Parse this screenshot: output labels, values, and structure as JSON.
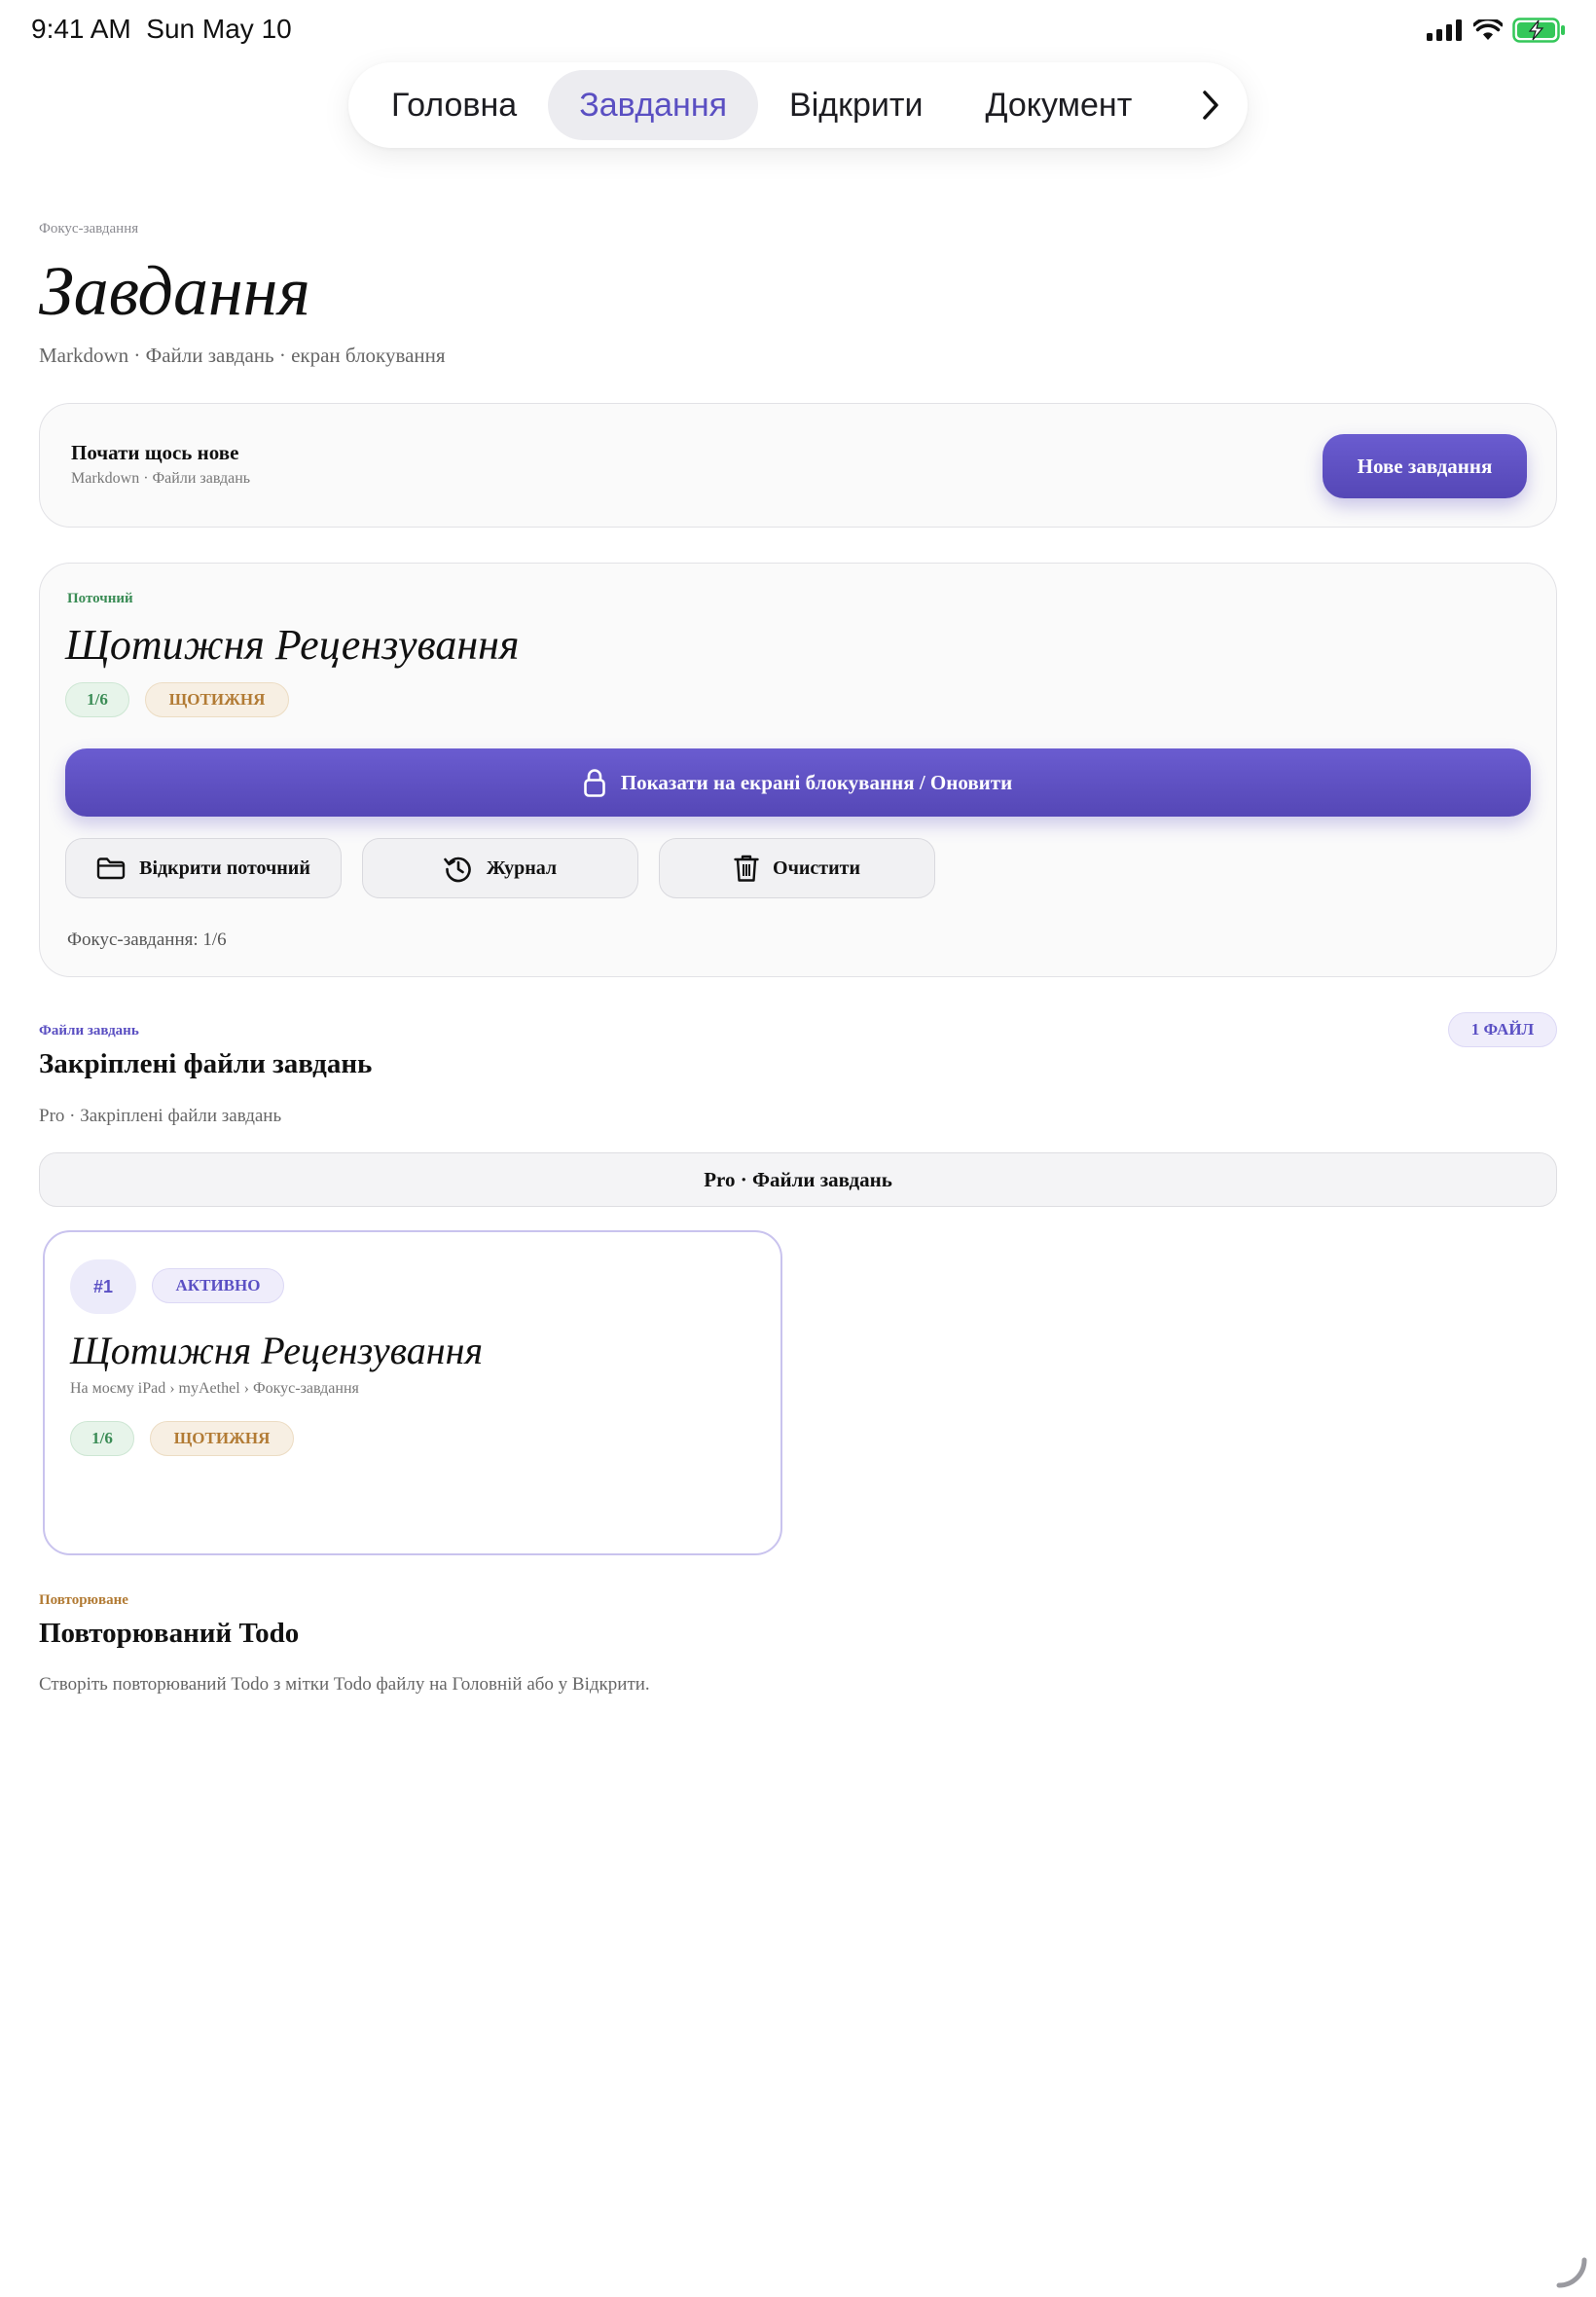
{
  "status": {
    "time": "9:41 AM",
    "date": "Sun May 10"
  },
  "tabs": [
    {
      "label": "Головна",
      "active": false
    },
    {
      "label": "Завдання",
      "active": true
    },
    {
      "label": "Відкрити",
      "active": false
    },
    {
      "label": "Документ",
      "active": false
    }
  ],
  "header": {
    "eyebrow": "Фокус-завдання",
    "title": "Завдання",
    "subtitle": "Markdown · Файли завдань · екран блокування"
  },
  "new_task": {
    "title": "Почати щось нове",
    "subtitle": "Markdown · Файли завдань",
    "button": "Нове завдання"
  },
  "current": {
    "eyebrow": "Поточний",
    "title": "Щотижня Рецензування",
    "progress_chip": "1/6",
    "recurrence_chip": "ЩОТИЖНЯ",
    "lock_button": "Показати на екрані блокування / Оновити",
    "open_button": "Відкрити поточний",
    "log_button": "Журнал",
    "clear_button": "Очистити",
    "footer": "Фокус-завдання: 1/6"
  },
  "task_files": {
    "eyebrow": "Файли завдань",
    "title": "Закріплені файли завдань",
    "subtitle": "Pro · Закріплені файли завдань",
    "count_badge": "1 ФАЙЛ",
    "pro_bar": "Pro · Файли завдань",
    "files": [
      {
        "number": "#1",
        "status": "АКТИВНО",
        "title": "Щотижня Рецензування",
        "path": "На моєму iPad › myAethel › Фокус-завдання",
        "progress": "1/6",
        "recurrence": "ЩОТИЖНЯ"
      }
    ]
  },
  "recurring": {
    "eyebrow": "Повторюване",
    "title": "Повторюваний Todo",
    "description": "Створіть повторюваний Todo з мітки Todo файлу на Головній або у Відкрити."
  },
  "colors": {
    "accent": "#5a4fc2",
    "green": "#3a8c55",
    "gold": "#b27b34"
  }
}
